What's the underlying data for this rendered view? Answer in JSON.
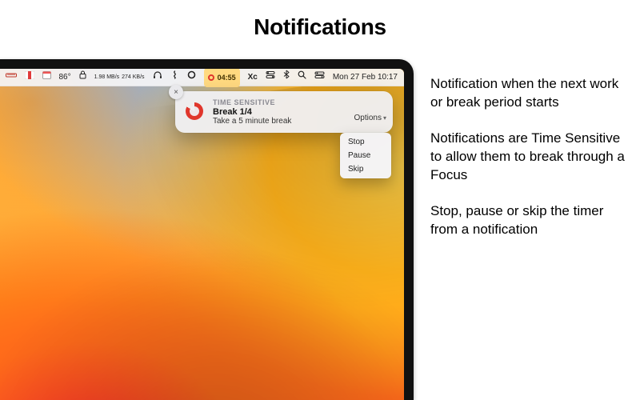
{
  "page": {
    "heading": "Notifications"
  },
  "menubar": {
    "temperature": "86°",
    "net_up": "1.98 MB/s",
    "net_down": "274 KB/s",
    "timer": "04:55",
    "xc_label": "Xc",
    "datetime": "Mon 27 Feb  10:17"
  },
  "notification": {
    "close_glyph": "×",
    "sensitive_label": "TIME SENSITIVE",
    "title": "Break 1/4",
    "subtitle": "Take a 5 minute break",
    "options_label": "Options"
  },
  "options_menu": {
    "items": [
      {
        "label": "Stop"
      },
      {
        "label": "Pause"
      },
      {
        "label": "Skip"
      }
    ]
  },
  "copy": {
    "p1": "Notification when the next work or break period starts",
    "p2": "Notifications are Time Sensitive to allow them to break through a Focus",
    "p3": "Stop, pause or skip the timer from a notification"
  }
}
